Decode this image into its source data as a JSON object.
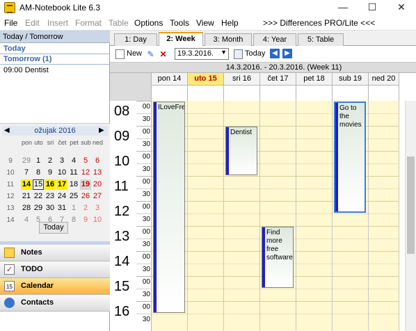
{
  "window": {
    "title": "AM-Notebook Lite  6.3",
    "minimize": "—",
    "maximize": "☐",
    "close": "✕"
  },
  "menu": [
    "File",
    "Edit",
    "Insert",
    "Format",
    "Table",
    "Options",
    "Tools",
    "View",
    "Help",
    ">>> Differences PRO/Lite <<<"
  ],
  "left": {
    "header": "Today / Tomorrow",
    "today_label": "Today",
    "tomorrow_label": "Tomorrow (1)",
    "tomorrow_items": [
      "09:00 Dentist"
    ],
    "calendar": {
      "month": "ožujak 2016",
      "prev": "◀",
      "next": "▶",
      "daynames": [
        "pon",
        "uto",
        "sri",
        "čet",
        "pet",
        "sub",
        "ned"
      ],
      "weeks": [
        "9",
        "10",
        "11",
        "12",
        "13",
        "14"
      ],
      "rows": [
        [
          "29",
          "1",
          "2",
          "3",
          "4",
          "5",
          "6"
        ],
        [
          "7",
          "8",
          "9",
          "10",
          "11",
          "12",
          "13"
        ],
        [
          "14",
          "15",
          "16",
          "17",
          "18",
          "19",
          "20"
        ],
        [
          "21",
          "22",
          "23",
          "24",
          "25",
          "26",
          "27"
        ],
        [
          "28",
          "29",
          "30",
          "31",
          "1",
          "2",
          "3"
        ],
        [
          "4",
          "5",
          "6",
          "7",
          "8",
          "9",
          "10"
        ]
      ],
      "today_button": "Today"
    },
    "nav": [
      {
        "label": "Notes",
        "icon": "notes-icon"
      },
      {
        "label": "TODO",
        "icon": "todo-icon"
      },
      {
        "label": "Calendar",
        "icon": "calendar-icon",
        "active": true
      },
      {
        "label": "Contacts",
        "icon": "contacts-icon"
      }
    ]
  },
  "tabs": [
    "1: Day",
    "2: Week",
    "3: Month",
    "4: Year",
    "5: Table"
  ],
  "active_tab": "2: Week",
  "toolbar": {
    "new_label": "New",
    "date_value": "19.3.2016.",
    "today_label": "Today"
  },
  "range_label": "14.3.2016.  -  20.3.2016.   (Week 11)",
  "days": [
    "pon 14",
    "uto 15",
    "sri 16",
    "čet 17",
    "pet 18",
    "sub 19",
    "ned 20"
  ],
  "today_index": 1,
  "hours": [
    "08",
    "09",
    "10",
    "11",
    "12",
    "13",
    "14",
    "15",
    "16"
  ],
  "minutes": [
    "00",
    "30"
  ],
  "events": [
    {
      "title": "ILoveFreeParty",
      "day": 0,
      "start": "08:00",
      "end": "16:30"
    },
    {
      "title": "Dentist",
      "day": 2,
      "start": "09:00",
      "end": "11:00"
    },
    {
      "title": "Find more free software",
      "day": 3,
      "start": "13:00",
      "end": "15:30"
    },
    {
      "title": "Go to the movies",
      "day": 5,
      "start": "08:00",
      "end": "12:30",
      "selected": true
    }
  ]
}
